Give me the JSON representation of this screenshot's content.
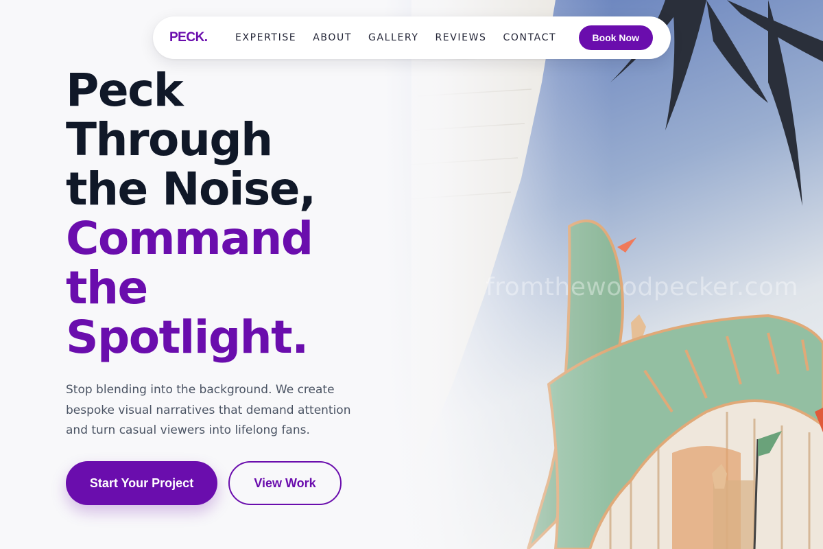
{
  "nav": {
    "logo": "PECK.",
    "links": [
      "EXPERTISE",
      "ABOUT",
      "GALLERY",
      "REVIEWS",
      "CONTACT"
    ],
    "book_label": "Book Now"
  },
  "hero": {
    "headline_dark": [
      "Peck",
      "Through",
      "the Noise,"
    ],
    "headline_accent": [
      "Command",
      "the",
      "Spotlight."
    ],
    "subtitle": "Stop blending into the background. We create bespoke visual narratives that demand attention and turn casual viewers into lifelong fans.",
    "primary_cta": "Start Your Project",
    "secondary_cta": "View Work",
    "watermark": "fromthewoodpecker.com"
  },
  "colors": {
    "accent": "#6a0dad",
    "heading": "#101828",
    "body_text": "#4a5363",
    "background": "#f8f8fa"
  }
}
